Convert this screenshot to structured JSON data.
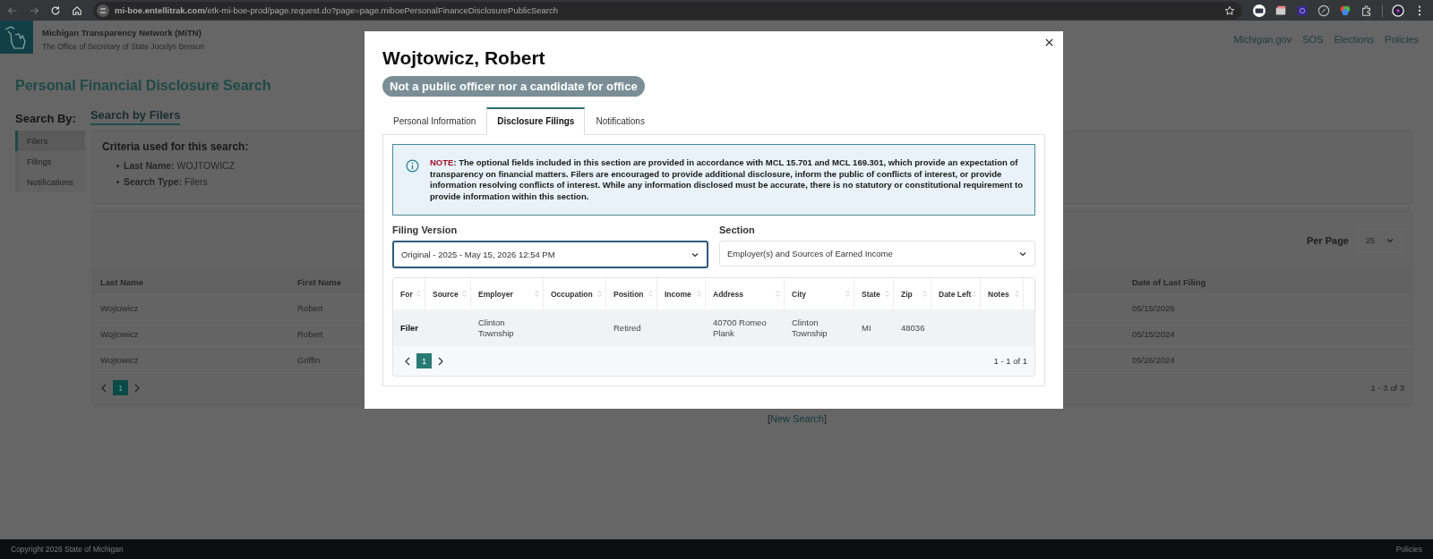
{
  "browser": {
    "url": "**mi-boe.entellitrak.com**/etk-mi-boe-prod/page.request.do?page=page.miboePersonalFinanceDisclosurePublicSearch"
  },
  "header": {
    "site_title": "Michigan Transparency Network (MiTN)",
    "subtitle": "The Office of Secretary of State Jocelyn Benson",
    "nav": [
      "Michigan.gov",
      "SOS",
      "Elections",
      "Policies"
    ]
  },
  "page_title": "Personal Financial Disclosure Search",
  "search_by_label": "Search By:",
  "search_heading": "Search by Filers",
  "sidebar": {
    "items": [
      {
        "label": "Filers",
        "selected": true
      },
      {
        "label": "Filings",
        "selected": false
      },
      {
        "label": "Notifications",
        "selected": false
      }
    ]
  },
  "criteria": {
    "heading": "Criteria used for this search:",
    "items": [
      {
        "label": "Last Name:",
        "value": "WOJTOWICZ"
      },
      {
        "label": "Search Type:",
        "value": "Filers"
      }
    ]
  },
  "results": {
    "per_page_label": "Per Page",
    "per_page_value": "25",
    "columns": [
      "Last Name",
      "First Name",
      "Date of Last Filing"
    ],
    "rows": [
      [
        "Wojtowicz",
        "Robert",
        "05/15/2026"
      ],
      [
        "Wojtowicz",
        "Robert",
        "05/15/2024"
      ],
      [
        "Wojtowicz",
        "Griffin",
        "05/26/2024"
      ]
    ],
    "page": "1",
    "range": "1 - 3 of 3"
  },
  "new_search": {
    "open": "[",
    "label": "New Search",
    "close": "]"
  },
  "footer": {
    "copyright": "Copyright 2026 State of Michigan",
    "link": "Policies"
  },
  "modal": {
    "title": "Wojtowicz, Robert",
    "status": "Not a public officer nor a candidate for office",
    "tabs": [
      {
        "label": "Personal Information",
        "selected": false
      },
      {
        "label": "Disclosure Filings",
        "selected": true
      },
      {
        "label": "Notifications",
        "selected": false
      }
    ],
    "note": {
      "label": "NOTE",
      "text": ": The optional fields included in this section are provided in accordance with MCL 15.701 and MCL 169.301, which provide an expectation of transparency on financial matters. Filers are encouraged to provide additional disclosure, inform the public of conflicts of interest, or provide information resolving conflicts of interest. While any information disclosed must be accurate, there is no statutory or constitutional requirement to provide information within this section."
    },
    "filters": [
      {
        "label": "Filing Version",
        "value": "Original - 2025 - May 15, 2026 12:54 PM",
        "focused": true
      },
      {
        "label": "Section",
        "value": "Employer(s) and Sources of Earned Income",
        "focused": false
      }
    ],
    "table": {
      "columns": [
        "For",
        "Source",
        "Employer",
        "Occupation",
        "Position",
        "Income",
        "Address",
        "City",
        "State",
        "Zip",
        "Date Left",
        "Notes"
      ],
      "rows": [
        [
          "Filer",
          null,
          "Clinton Township",
          null,
          "Retired",
          null,
          "40700 Romeo Plank",
          "Clinton Township",
          "MI",
          "48036",
          null,
          null
        ]
      ],
      "page": "1",
      "range": "1 - 1 of 1"
    }
  }
}
